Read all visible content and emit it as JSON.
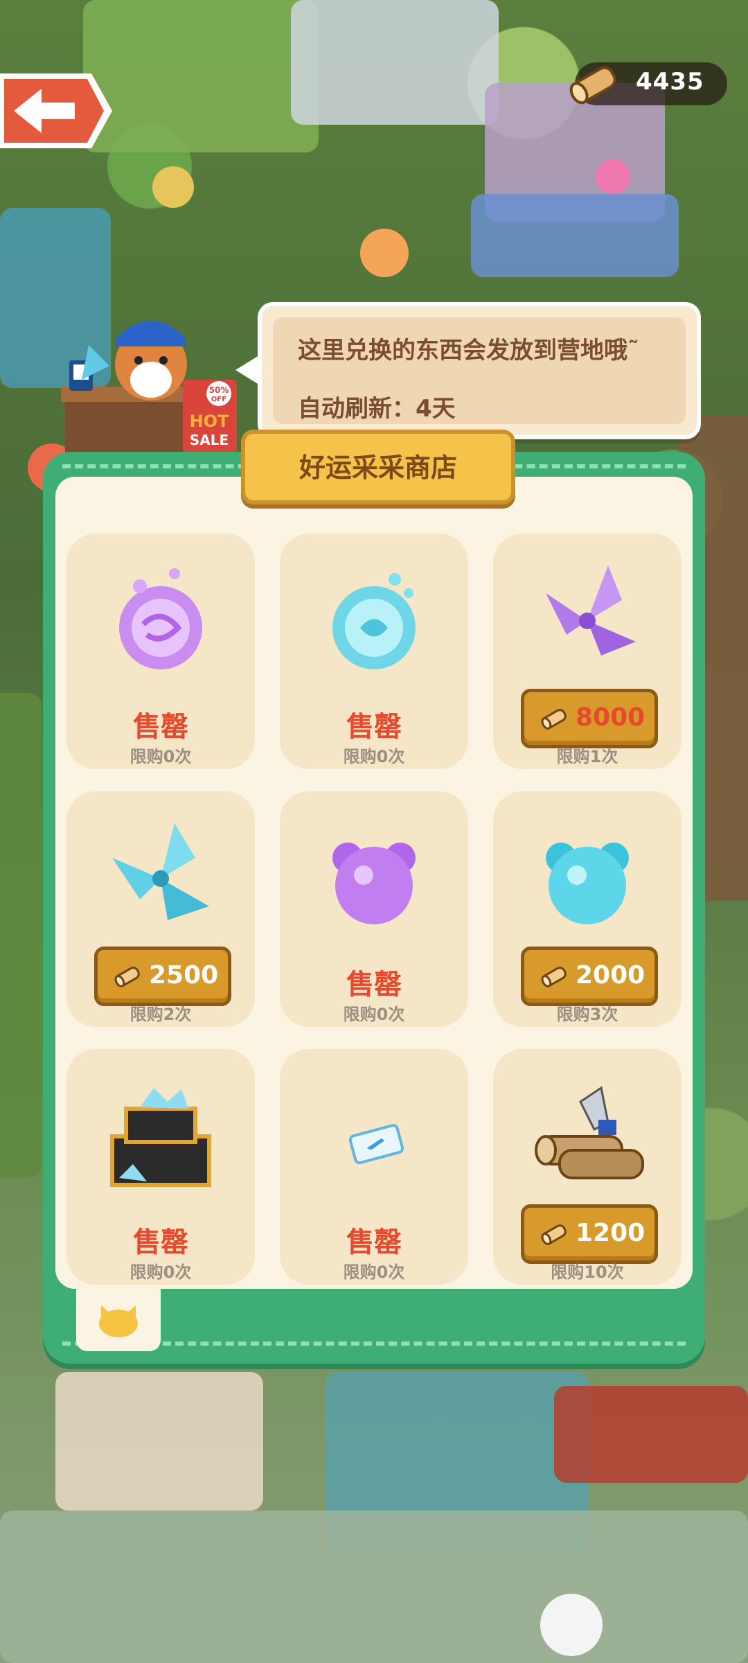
{
  "header": {
    "currency_amount": "4435"
  },
  "npc_bubble": {
    "line1": "这里兑换的东西会发放到营地哦˜",
    "line2": "自动刷新：4天"
  },
  "badge": {
    "text1": "50%",
    "text2": "OFF",
    "text3": "HOT",
    "text4": "SALE"
  },
  "shop": {
    "title": "好运采采商店",
    "items": [
      {
        "name": "purple-orb",
        "status": "售罄",
        "price": null,
        "limit": "限购0次"
      },
      {
        "name": "blue-orb",
        "status": "售罄",
        "price": null,
        "limit": "限购0次"
      },
      {
        "name": "purple-pinwheel",
        "status": null,
        "price": "8000",
        "limit": "限购1次"
      },
      {
        "name": "blue-pinwheel",
        "status": null,
        "price": "2500",
        "limit": "限购2次"
      },
      {
        "name": "purple-bear-orb",
        "status": "售罄",
        "price": null,
        "limit": "限购0次"
      },
      {
        "name": "blue-bear-orb",
        "status": null,
        "price": "2000",
        "limit": "限购3次"
      },
      {
        "name": "gem-chest",
        "status": "售罄",
        "price": null,
        "limit": "限购0次"
      },
      {
        "name": "ticket",
        "status": "售罄",
        "price": null,
        "limit": "限购0次"
      },
      {
        "name": "wood-logs",
        "status": null,
        "price": "1200",
        "limit": "限购10次"
      }
    ]
  },
  "colors": {
    "panel_green": "#3fae74",
    "soldout_red": "#e54a2f",
    "price_gold": "#d89a2a"
  }
}
